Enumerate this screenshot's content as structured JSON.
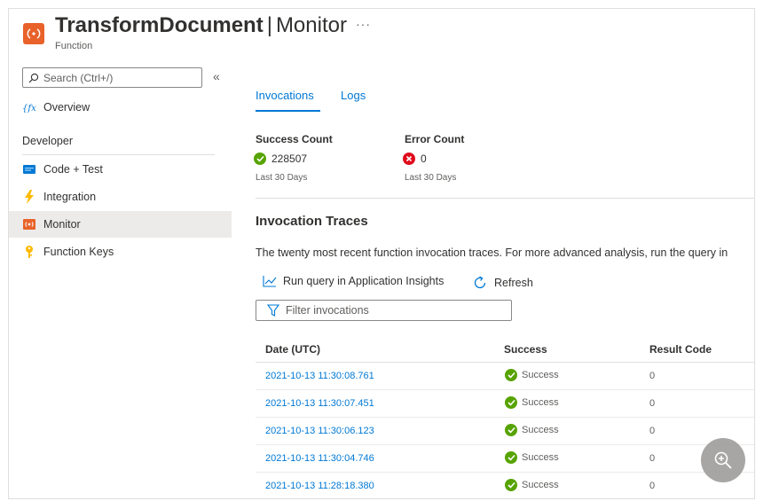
{
  "header": {
    "title_strong": "TransformDocument",
    "title_sep": "|",
    "title_rest": "Monitor",
    "more": "···",
    "subtitle": "Function",
    "icon": "function-app-icon",
    "icon_color": "#e8622a"
  },
  "sidebar": {
    "search_placeholder": "Search (Ctrl+/)",
    "collapse_glyph": "«",
    "overview": {
      "label": "Overview",
      "icon": "function-fx-icon"
    },
    "section": "Developer",
    "items": [
      {
        "label": "Code + Test",
        "icon": "code-icon",
        "selected": false
      },
      {
        "label": "Integration",
        "icon": "lightning-icon",
        "selected": false
      },
      {
        "label": "Monitor",
        "icon": "monitor-icon",
        "selected": true
      },
      {
        "label": "Function Keys",
        "icon": "key-icon",
        "selected": false
      }
    ]
  },
  "main": {
    "tabs": [
      {
        "label": "Invocations",
        "active": true
      },
      {
        "label": "Logs",
        "active": false
      }
    ],
    "metrics": {
      "success": {
        "label": "Success Count",
        "value": "228507",
        "period": "Last 30 Days",
        "color": "#57a300"
      },
      "error": {
        "label": "Error Count",
        "value": "0",
        "period": "Last 30 Days",
        "color": "#e00b1c"
      }
    },
    "traces": {
      "title": "Invocation Traces",
      "description": "The twenty most recent function invocation traces. For more advanced analysis, run the query in"
    },
    "commands": {
      "run_query": "Run query in Application Insights",
      "refresh": "Refresh"
    },
    "filter_placeholder": "Filter invocations",
    "table": {
      "columns": [
        "Date (UTC)",
        "Success",
        "Result Code"
      ],
      "rows": [
        {
          "date": "2021-10-13 11:30:08.761",
          "success": "Success",
          "code": "0"
        },
        {
          "date": "2021-10-13 11:30:07.451",
          "success": "Success",
          "code": "0"
        },
        {
          "date": "2021-10-13 11:30:06.123",
          "success": "Success",
          "code": "0"
        },
        {
          "date": "2021-10-13 11:30:04.746",
          "success": "Success",
          "code": "0"
        },
        {
          "date": "2021-10-13 11:28:18.380",
          "success": "Success",
          "code": "0"
        }
      ]
    }
  },
  "colors": {
    "accent": "#0078d4",
    "success": "#57a300",
    "error": "#e00b1c"
  }
}
